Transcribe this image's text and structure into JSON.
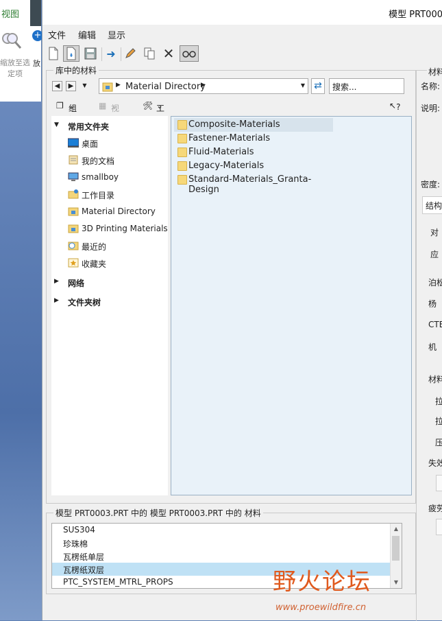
{
  "background_app": {
    "tab_label": "视图",
    "button_label_line1": "缩放至选",
    "button_label_line2": "定项",
    "partial_label": "放"
  },
  "dialog": {
    "title": "模型 PRT000",
    "menu": [
      "文件",
      "编辑",
      "显示"
    ],
    "toolbar_icons": [
      "new-file-icon",
      "open-file-icon",
      "save-icon",
      "arrow-right-icon",
      "pencil-icon",
      "copy-icon",
      "delete-icon",
      "glasses-icon"
    ]
  },
  "library": {
    "legend": "库中的材料",
    "address": "Material Directory",
    "search_placeholder": "搜索...",
    "organize": "组织",
    "view": "视图",
    "tools": "工具",
    "help": "?"
  },
  "tree": {
    "favorites_header": "常用文件夹",
    "favorites": [
      "桌面",
      "我的文档",
      "smallboy",
      "工作目录",
      "Material Directory",
      "3D Printing Materials",
      "最近的",
      "收藏夹"
    ],
    "network": "网络",
    "folder_tree": "文件夹树"
  },
  "files": [
    "Composite-Materials",
    "Fastener-Materials",
    "Fluid-Materials",
    "Legacy-Materials",
    "Standard-Materials_Granta-Design"
  ],
  "model_materials": {
    "legend": "模型 PRT0003.PRT 中的 模型 PRT0003.PRT 中的 材料",
    "items": [
      "SUS304",
      "珍珠棉",
      "瓦楞纸单层",
      "瓦楞纸双层",
      "PTC_SYSTEM_MTRL_PROPS"
    ],
    "selected_index": 3
  },
  "properties_panel": {
    "legend": "材料",
    "name_label": "名称:",
    "desc_label": "说明:",
    "density_label": "密度:",
    "tab_label": "结构",
    "labels": [
      "对",
      "应",
      "泊松",
      "杨",
      "CTE",
      "机",
      "材料",
      "拉",
      "拉",
      "压",
      "失效",
      "疲劳"
    ]
  },
  "watermark": {
    "text": "野火论坛",
    "url": "www.proewildfire.cn"
  }
}
